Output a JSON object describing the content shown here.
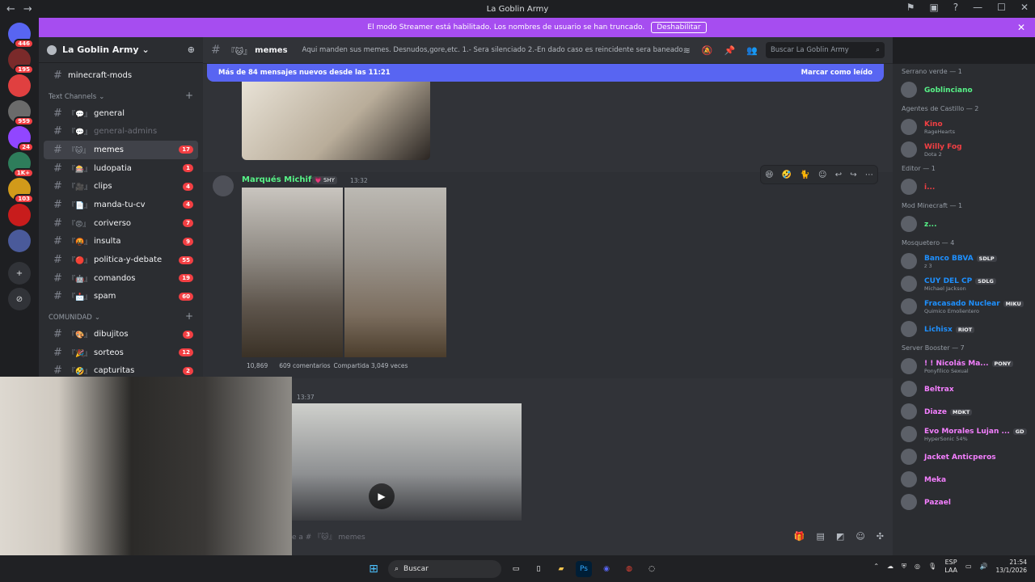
{
  "window": {
    "title": "La Goblin Army"
  },
  "banner": {
    "text": "El modo Streamer está habilitado. Los nombres de usuario se han truncado.",
    "button": "Deshabilitar"
  },
  "servers": [
    {
      "badge": "446",
      "color": "#5865f2",
      "icon": "discord-icon"
    },
    {
      "badge": "195",
      "color": "#7a2a2a",
      "icon": "server-icon"
    },
    {
      "badge": "",
      "color": "#e04040",
      "icon": "server-icon"
    },
    {
      "badge": "959",
      "color": "#6b6b6b",
      "icon": "server-icon"
    },
    {
      "badge": "24",
      "color": "#9146ff",
      "icon": "twitch-icon"
    },
    {
      "badge": "1K+",
      "color": "#2e7d5b",
      "icon": "server-icon"
    },
    {
      "badge": "103",
      "color": "#d19a1a",
      "icon": "server-icon"
    },
    {
      "badge": "",
      "color": "#c81c1c",
      "icon": "server-icon"
    },
    {
      "badge": "",
      "color": "#4a5a9a",
      "icon": "server-icon"
    }
  ],
  "sidebar": {
    "guild_name": "La Goblin Army",
    "top_channel": "minecraft-mods",
    "category_text": "Text Channels",
    "category_community": "COMUNIDAD",
    "channels": [
      {
        "emoji": "『💬』",
        "name": "general",
        "count": "",
        "state": "unread"
      },
      {
        "emoji": "『💬』",
        "name": "general-admins",
        "count": "",
        "state": "muted"
      },
      {
        "emoji": "『🐱』",
        "name": "memes",
        "count": "17",
        "state": "active"
      },
      {
        "emoji": "『🎰』",
        "name": "ludopatia",
        "count": "1",
        "state": "unread"
      },
      {
        "emoji": "『🎥』",
        "name": "clips",
        "count": "4",
        "state": "unread"
      },
      {
        "emoji": "『📄』",
        "name": "manda-tu-cv",
        "count": "4",
        "state": "unread"
      },
      {
        "emoji": "『😡』",
        "name": "coriverso",
        "count": "7",
        "state": "unread"
      },
      {
        "emoji": "『🤬』",
        "name": "insulta",
        "count": "9",
        "state": "unread"
      },
      {
        "emoji": "『🔴』",
        "name": "politica-y-debate",
        "count": "55",
        "state": "unread"
      },
      {
        "emoji": "『🤖』",
        "name": "comandos",
        "count": "19",
        "state": "unread"
      },
      {
        "emoji": "『📩』",
        "name": "spam",
        "count": "60",
        "state": "unread"
      }
    ],
    "community_channels": [
      {
        "emoji": "『🎨』",
        "name": "dibujitos",
        "count": "3",
        "state": "unread"
      },
      {
        "emoji": "『🎉』",
        "name": "sorteos",
        "count": "12",
        "state": "unread"
      },
      {
        "emoji": "『🤣』",
        "name": "capturitas",
        "count": "2",
        "state": "unread"
      }
    ]
  },
  "channel_header": {
    "emoji": "『🐱』",
    "name": "memes",
    "topic": "Aqui manden sus memes. Desnudos,gore,etc. 1.- Sera silenciado 2.-En dado caso es reincidente sera baneado",
    "search_placeholder": "Buscar La Goblin Army"
  },
  "new_messages": {
    "text": "Más de 84 mensajes nuevos desde las 11:21",
    "action": "Marcar como leído"
  },
  "message": {
    "author": "Marqués Michifus",
    "tag": "💗 SHY",
    "time": "13:32",
    "reactions": "10,869",
    "comments": "609 comentarios",
    "shares": "Compartida 3,049 veces"
  },
  "message2": {
    "time": "13:37"
  },
  "composer": {
    "placeholder": "e a # 『🐱』 memes"
  },
  "members": {
    "categories": [
      {
        "title": "Serrano verde — 1",
        "items": [
          {
            "name": "Goblinciano",
            "color": "#57f287",
            "tag": "",
            "sub": ""
          }
        ]
      },
      {
        "title": "Agentes de Castillo — 2",
        "items": [
          {
            "name": "Kino",
            "color": "#f23f43",
            "tag": "",
            "sub": "RageHearts"
          },
          {
            "name": "Willy Fog",
            "color": "#f23f43",
            "tag": "",
            "sub": "Dota 2"
          }
        ]
      },
      {
        "title": "Editor — 1",
        "items": [
          {
            "name": "i...",
            "color": "#f23f43",
            "tag": "",
            "sub": ""
          }
        ]
      },
      {
        "title": "Mod Minecraft — 1",
        "items": [
          {
            "name": "z...",
            "color": "#57f287",
            "tag": "",
            "sub": ""
          }
        ]
      },
      {
        "title": "Mosquetero — 4",
        "items": [
          {
            "name": "Banco BBVA",
            "color": "#1e90ff",
            "tag": "SDLP",
            "sub": "z 3"
          },
          {
            "name": "CUY DEL CP",
            "color": "#1e90ff",
            "tag": "SDLG",
            "sub": "Michael Jackson"
          },
          {
            "name": "Fracasado Nuclear",
            "color": "#1e90ff",
            "tag": "MIKU",
            "sub": "Quimico Emolientero"
          },
          {
            "name": "Lichisx",
            "color": "#1e90ff",
            "tag": "RIOT",
            "sub": ""
          }
        ]
      },
      {
        "title": "Server Booster — 7",
        "items": [
          {
            "name": "! ! Nicolás Ma...",
            "color": "#f47fff",
            "tag": "PONY",
            "sub": "Ponyfílico Sexual"
          },
          {
            "name": "Beltrax",
            "color": "#f47fff",
            "tag": "",
            "sub": ""
          },
          {
            "name": "Diaze",
            "color": "#f47fff",
            "tag": "MDKT",
            "sub": ""
          },
          {
            "name": "Evo Morales Lujan ...",
            "color": "#f47fff",
            "tag": "GD",
            "sub": "HyperSonic 54%"
          },
          {
            "name": "Jacket Anticperos",
            "color": "#f47fff",
            "tag": "",
            "sub": ""
          },
          {
            "name": "Meka",
            "color": "#f47fff",
            "tag": "",
            "sub": ""
          },
          {
            "name": "Pazael",
            "color": "#f47fff",
            "tag": "",
            "sub": ""
          }
        ]
      }
    ]
  },
  "taskbar": {
    "search": "Buscar",
    "lang": "ESP",
    "lang2": "LAA",
    "time": "21:54",
    "date": "13/1/2026"
  }
}
